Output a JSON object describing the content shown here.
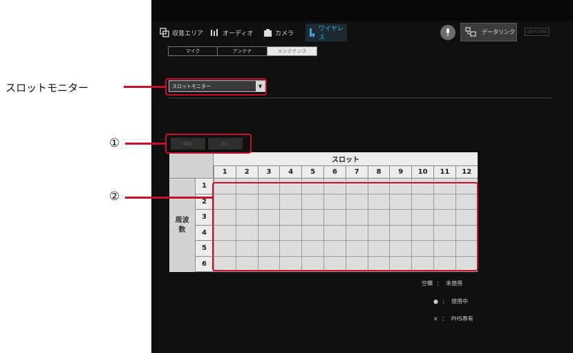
{
  "top_tabs": [
    {
      "label": "収音エリア",
      "icon": "area-icon",
      "active": false
    },
    {
      "label": "オーディオ",
      "icon": "audio-icon",
      "active": false
    },
    {
      "label": "カメラ",
      "icon": "camera-icon",
      "active": false
    },
    {
      "label": "ワイヤレス",
      "icon": "wireless-icon",
      "active": true
    }
  ],
  "header": {
    "mic_icon": "microphone-icon",
    "datalink_label": "データリンク",
    "offline_label": "OFFLINE"
  },
  "sub_tabs": [
    {
      "label": "マイク",
      "active": false
    },
    {
      "label": "アンテナ",
      "active": false
    },
    {
      "label": "メンテナンス",
      "active": true
    }
  ],
  "dropdown": {
    "value": "スロットモニター"
  },
  "buttons": {
    "start": "開始",
    "stop": "停止"
  },
  "grid": {
    "slot_title": "スロット",
    "columns": [
      "1",
      "2",
      "3",
      "4",
      "5",
      "6",
      "7",
      "8",
      "9",
      "10",
      "11",
      "12"
    ],
    "row_group_label": "周波\n数",
    "rows": [
      "1",
      "2",
      "3",
      "4",
      "5",
      "6"
    ]
  },
  "legend": [
    {
      "symbol": "空欄",
      "sep": "：",
      "text": "未使用"
    },
    {
      "symbol": "●",
      "sep": "：",
      "text": "使用中"
    },
    {
      "symbol": "×",
      "sep": "：",
      "text": "PHS専有"
    }
  ],
  "annotations": {
    "dropdown_callout": "スロットモニター",
    "callout_1": "①",
    "callout_2": "②"
  },
  "colors": {
    "accent": "#2fb0d8",
    "callout_red": "#c8102e",
    "app_background": "#101010"
  }
}
